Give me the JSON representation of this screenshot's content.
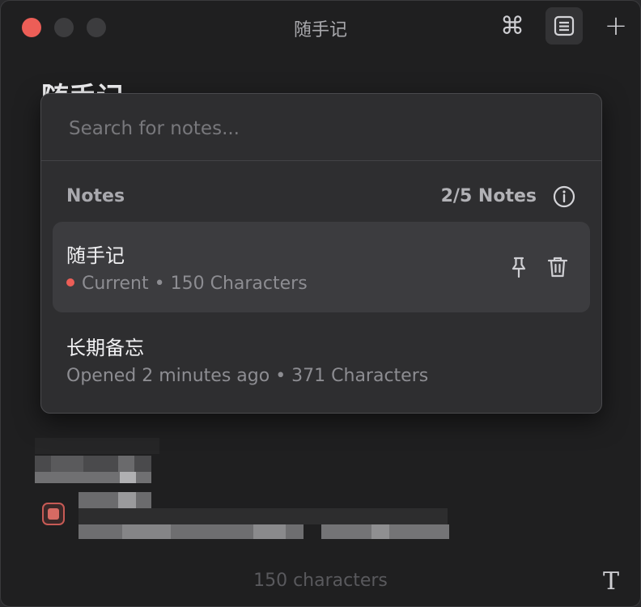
{
  "window": {
    "title": "随手记",
    "note_heading": "随手记"
  },
  "toolbar": {
    "command_icon": "command-icon",
    "notes_list_icon": "notes-list-icon",
    "new_note_icon": "plus-icon"
  },
  "popover": {
    "search_placeholder": "Search for notes...",
    "section_label": "Notes",
    "count_label": "2/5 Notes",
    "notes": [
      {
        "title": "随手记",
        "status": "Current",
        "meta": "Current • 150 Characters",
        "active": true
      },
      {
        "title": "长期备忘",
        "meta": "Opened 2 minutes ago • 371 Characters",
        "active": false
      }
    ]
  },
  "footer": {
    "char_count": "150 characters",
    "format_icon": "T"
  },
  "colors": {
    "accent_red": "#ec5e57",
    "background": "#1f1f20",
    "popover": "#2e2e30"
  }
}
